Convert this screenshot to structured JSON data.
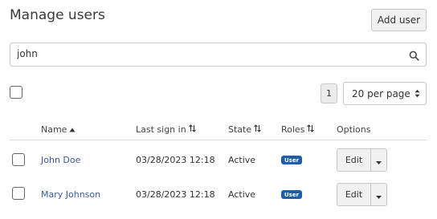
{
  "page": {
    "title": "Manage users",
    "add_user_label": "Add user"
  },
  "search": {
    "value": "john",
    "icon": "search-icon"
  },
  "pagination": {
    "current_page": "1",
    "per_page": "20 per page"
  },
  "table": {
    "columns": {
      "name": "Name",
      "last_sign_in": "Last sign in",
      "state": "State",
      "roles": "Roles",
      "options": "Options"
    },
    "rows": [
      {
        "name": "John Doe",
        "last_sign_in": "03/28/2023 12:18",
        "state": "Active",
        "role": "User",
        "edit_label": "Edit"
      },
      {
        "name": "Mary Johnson",
        "last_sign_in": "03/28/2023 12:18",
        "state": "Active",
        "role": "User",
        "edit_label": "Edit"
      }
    ]
  },
  "colors": {
    "link": "#3a5a9a",
    "badge": "#1f5fa8",
    "border": "#c8c8c8",
    "button_bg": "#f1f1f1"
  }
}
